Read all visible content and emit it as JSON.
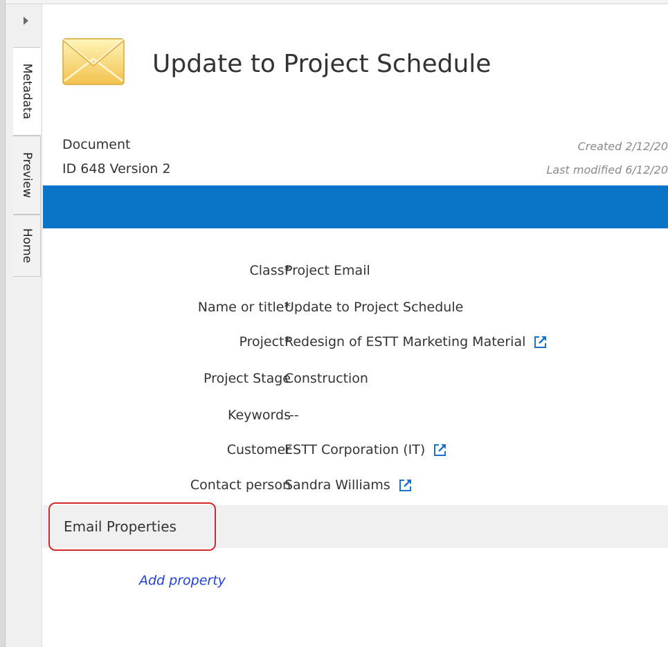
{
  "tabs": [
    {
      "label": "Metadata",
      "active": true
    },
    {
      "label": "Preview",
      "active": false
    },
    {
      "label": "Home",
      "active": false
    }
  ],
  "document": {
    "title": "Update to Project Schedule",
    "type": "Document",
    "id": "ID 648",
    "version": "Version 2",
    "created": "Created 2/12/20",
    "last_modified": "Last modified 6/12/20"
  },
  "properties": [
    {
      "label": "Class*",
      "value": "Project Email",
      "link": false
    },
    {
      "label": "Name or title*",
      "value": "Update to Project Schedule",
      "link": false
    },
    {
      "label": "Project*",
      "value": "Redesign of ESTT Marketing Material",
      "link": true
    },
    {
      "label": "Project Stage",
      "value": "Construction",
      "link": false
    },
    {
      "label": "Keywords",
      "value": "---",
      "link": false
    },
    {
      "label": "Customer",
      "value": "ESTT Corporation (IT)",
      "link": true
    },
    {
      "label": "Contact person",
      "value": "Sandra Williams",
      "link": true
    }
  ],
  "email_section": {
    "title": "Email Properties"
  },
  "add_property_label": "Add property",
  "colors": {
    "accent_bar": "#0a74c7",
    "link_icon": "#1a73c8",
    "add_property": "#1f3fe0",
    "highlight": "#d42828"
  },
  "icons": {
    "document": "envelope-icon",
    "link": "external-link-icon",
    "collapse": "expand-arrow-icon"
  }
}
